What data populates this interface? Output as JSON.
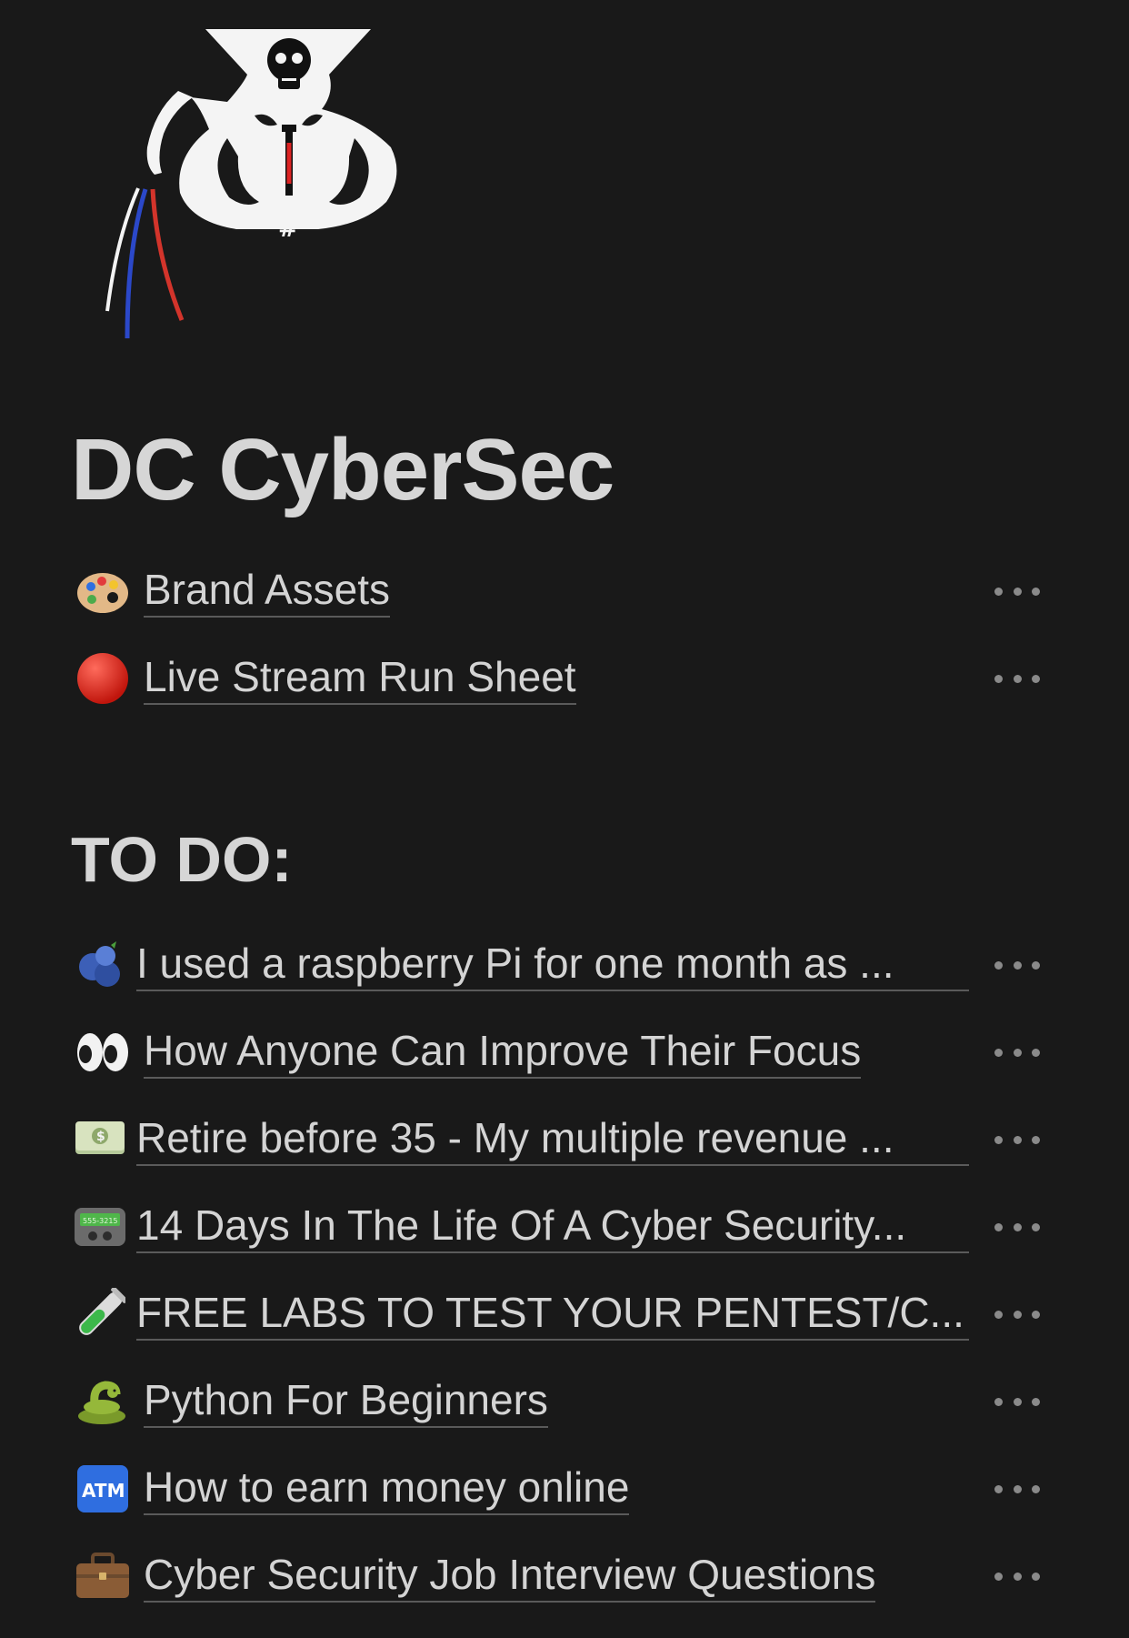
{
  "page": {
    "title": "DC CyberSec",
    "logo": {
      "icon": "skull-octopus-logo-icon",
      "text": "#"
    }
  },
  "pinned_pages": [
    {
      "icon": "palette-icon",
      "label": "Brand Assets"
    },
    {
      "icon": "red-circle-icon",
      "label": "Live Stream Run Sheet"
    }
  ],
  "todo": {
    "heading": "TO DO:",
    "items": [
      {
        "icon": "blueberries-icon",
        "label": "I used a raspberry Pi for one month as ..."
      },
      {
        "icon": "eyes-icon",
        "label": "How Anyone Can Improve Their Focus"
      },
      {
        "icon": "dollar-banknote-icon",
        "label": "Retire before 35 - My multiple revenue ..."
      },
      {
        "icon": "pager-icon",
        "label": "14 Days In The Life Of A Cyber Security..."
      },
      {
        "icon": "test-tube-icon",
        "label": "FREE LABS TO TEST YOUR PENTEST/C..."
      },
      {
        "icon": "snake-icon",
        "label": "Python For Beginners"
      },
      {
        "icon": "atm-sign-icon",
        "label": "How to earn money online"
      },
      {
        "icon": "briefcase-icon",
        "label": "Cyber Security Job Interview Questions"
      }
    ]
  },
  "icons_text": {
    "atm": "ATM",
    "pager": "555-3215"
  },
  "colors": {
    "background": "#191919",
    "text": "#d4d4d4",
    "underline": "#5a5a5a",
    "more_dots": "#8a8a8a"
  }
}
